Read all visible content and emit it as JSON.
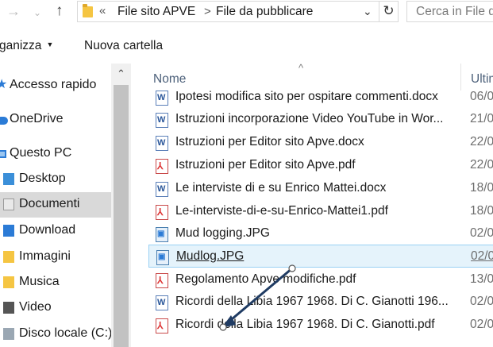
{
  "address_bar": {
    "back_icon": "arrow-left-icon",
    "forward_icon": "arrow-right-icon",
    "up_icon": "arrow-up-icon",
    "overflow": "«",
    "crumbs": [
      "File sito APVE",
      "File da pubblicare"
    ],
    "separator": ">",
    "search_placeholder": "Cerca in File d"
  },
  "toolbar": {
    "organize_label": "ganizza",
    "new_folder_label": "Nuova cartella"
  },
  "nav": {
    "items": [
      {
        "label": "Accesso rapido",
        "icon": "star-icon"
      },
      {
        "label": "OneDrive",
        "icon": "cloud-icon"
      },
      {
        "label": "Questo PC",
        "icon": "computer-icon"
      },
      {
        "label": "Desktop",
        "icon": "desktop-folder-icon"
      },
      {
        "label": "Documenti",
        "icon": "documents-folder-icon"
      },
      {
        "label": "Download",
        "icon": "download-folder-icon"
      },
      {
        "label": "Immagini",
        "icon": "pictures-folder-icon"
      },
      {
        "label": "Musica",
        "icon": "music-folder-icon"
      },
      {
        "label": "Video",
        "icon": "video-folder-icon"
      },
      {
        "label": "Disco locale (C:)",
        "icon": "disk-icon"
      }
    ],
    "selected": "Documenti"
  },
  "file_list": {
    "columns": {
      "name": "Nome",
      "date": "Ultim"
    },
    "rows": [
      {
        "name": "Ipotesi modifica sito per ospitare commenti.docx",
        "date": "06/0",
        "type": "docx"
      },
      {
        "name": "Istruzioni incorporazione Video YouTube in Wor...",
        "date": "21/0",
        "type": "docx"
      },
      {
        "name": "Istruzioni per Editor sito Apve.docx",
        "date": "22/0",
        "type": "docx"
      },
      {
        "name": "Istruzioni per Editor sito Apve.pdf",
        "date": "22/0",
        "type": "pdf"
      },
      {
        "name": "Le interviste di e su Enrico Mattei.docx",
        "date": "18/0",
        "type": "docx"
      },
      {
        "name": "Le-interviste-di-e-su-Enrico-Mattei1.pdf",
        "date": "18/0",
        "type": "pdf"
      },
      {
        "name": "Mud logging.JPG",
        "date": "02/0",
        "type": "jpg"
      },
      {
        "name": "Mudlog.JPG",
        "date": "02/0",
        "type": "jpg"
      },
      {
        "name": "Regolamento Apve modifiche.pdf",
        "date": "13/0",
        "type": "pdf"
      },
      {
        "name": "Ricordi della Libia 1967 1968. Di C. Gianotti 196...",
        "date": "02/0",
        "type": "docx"
      },
      {
        "name": "Ricordi della Libia 1967 1968. Di C. Gianotti.pdf",
        "date": "02/0",
        "type": "pdf"
      }
    ],
    "selected_row": "Mudlog.JPG"
  }
}
